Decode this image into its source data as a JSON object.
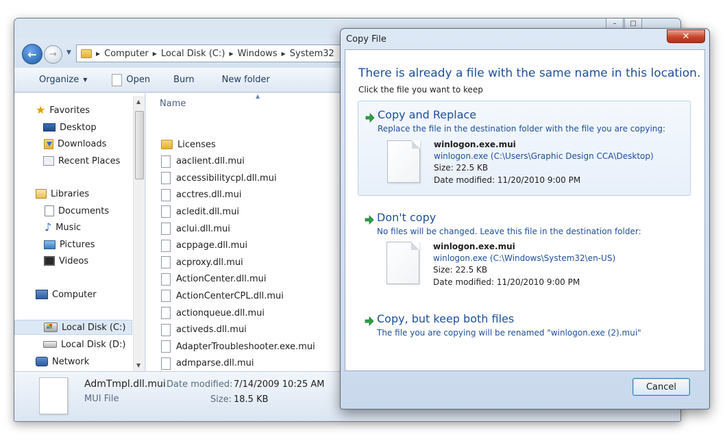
{
  "explorer": {
    "breadcrumbs": [
      "Computer",
      "Local Disk (C:)",
      "Windows",
      "System32"
    ],
    "toolbar": {
      "organize": "Organize",
      "open": "Open",
      "burn": "Burn",
      "new_folder": "New folder"
    },
    "nav": {
      "favorites": "Favorites",
      "desktop": "Desktop",
      "downloads": "Downloads",
      "recent_places": "Recent Places",
      "libraries": "Libraries",
      "documents": "Documents",
      "music": "Music",
      "pictures": "Pictures",
      "videos": "Videos",
      "computer": "Computer",
      "local_disk_c": "Local Disk (C:)",
      "local_disk_d": "Local Disk (D:)",
      "network": "Network"
    },
    "column_name": "Name",
    "files": [
      "Licenses",
      "aaclient.dll.mui",
      "accessibilitycpl.dll.mui",
      "acctres.dll.mui",
      "acledit.dll.mui",
      "aclui.dll.mui",
      "acppage.dll.mui",
      "acproxy.dll.mui",
      "ActionCenter.dll.mui",
      "ActionCenterCPL.dll.mui",
      "actionqueue.dll.mui",
      "activeds.dll.mui",
      "AdapterTroubleshooter.exe.mui",
      "admparse.dll.mui",
      "AdmTmpl.dll.mui"
    ],
    "details": {
      "name": "AdmTmpl.dll.mui",
      "type": "MUI File",
      "date_label": "Date modified:",
      "date_value": "7/14/2009 10:25 AM",
      "size_label": "Size:",
      "size_value": "18.5 KB"
    }
  },
  "dialog": {
    "title": "Copy File",
    "heading": "There is already a file with the same name in this location.",
    "subheading": "Click the file you want to keep",
    "options": [
      {
        "title": "Copy and Replace",
        "description": "Replace the file in the destination folder with the file you are copying:",
        "file_name": "winlogon.exe.mui",
        "file_path": "winlogon.exe (C:\\Users\\Graphic Design CCA\\Desktop)",
        "size": "Size: 22.5 KB",
        "date": "Date modified: 11/20/2010 9:00 PM"
      },
      {
        "title": "Don't copy",
        "description": "No files will be changed. Leave this file in the destination folder:",
        "file_name": "winlogon.exe.mui",
        "file_path": "winlogon.exe (C:\\Windows\\System32\\en-US)",
        "size": "Size: 22.5 KB",
        "date": "Date modified: 11/20/2010 9:00 PM"
      },
      {
        "title": "Copy, but keep both files",
        "description": "The file you are copying will be renamed \"winlogon.exe (2).mui\""
      }
    ],
    "cancel": "Cancel"
  },
  "colors": {
    "accent_blue": "#1d4f9a",
    "arrow_green": "#2ea043",
    "close_red": "#c8452c"
  }
}
